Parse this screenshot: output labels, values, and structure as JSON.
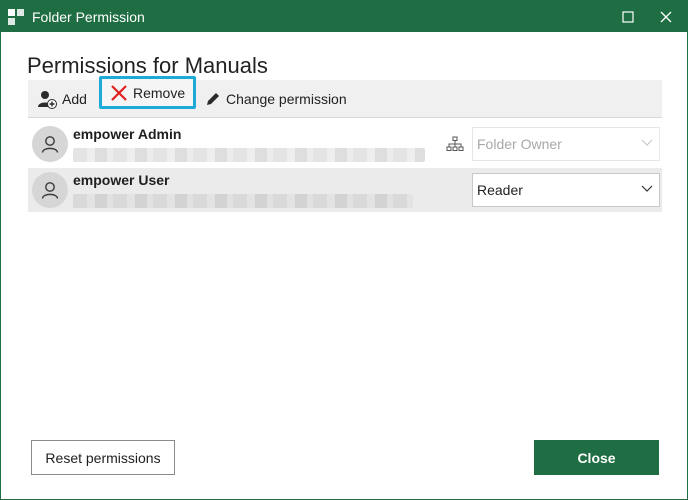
{
  "window": {
    "title": "Folder Permission",
    "accent_color": "#1f6e43"
  },
  "heading": "Permissions for Manuals",
  "toolbar": {
    "add_label": "Add",
    "remove_label": "Remove",
    "change_label": "Change permission",
    "remove_highlight_color": "#1eaad7"
  },
  "users": [
    {
      "name": "empower Admin",
      "permission": "Folder Owner",
      "permission_enabled": false,
      "icon": "org-chart-icon"
    },
    {
      "name": "empower User",
      "permission": "Reader",
      "permission_enabled": true
    }
  ],
  "footer": {
    "reset_label": "Reset permissions",
    "close_label": "Close"
  }
}
